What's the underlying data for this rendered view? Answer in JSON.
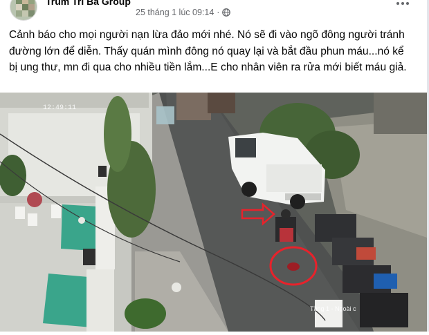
{
  "post": {
    "group_name": "Trùm Tri Bà Group",
    "date": "25 tháng 1 lúc 09:14",
    "separator": "·",
    "privacy_icon": "globe-icon",
    "more_icon": "more-dots-icon",
    "text_lines": [
      "Cảnh báo cho mọi người nạn lừa đảo mới nhé. Nó sẽ đi vào ngõ đông người tránh",
      "đường lớn để diễn. Thấy quán mình đông nó quay lại và bắt đầu phun máu...nó kể",
      "bị ung thư, mn đi qua cho nhiều tiền lắm...E cho nhân viên ra rửa mới biết máu giả."
    ]
  },
  "media": {
    "cctv_timestamp": "12:49:11",
    "camera_label": "Tầng 1 - Ngoài c",
    "annotation_colors": {
      "arrow": "#e8222b",
      "circle": "#e8222b"
    }
  }
}
